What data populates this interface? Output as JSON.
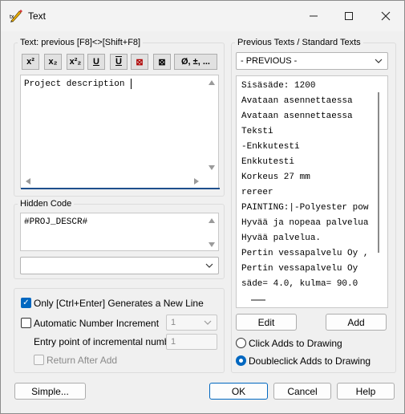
{
  "window": {
    "title": "Text"
  },
  "left": {
    "text_group": {
      "legend": "Text: previous [F8]<>[Shift+F8]",
      "toolbar": [
        {
          "name": "superscript-button",
          "label": "x²"
        },
        {
          "name": "subscript-button",
          "label": "x₂"
        },
        {
          "name": "sub-superscript-button",
          "label": "x²₂"
        },
        {
          "name": "underline-button",
          "label": "U"
        },
        {
          "name": "overline-underline-button",
          "label": "U"
        },
        {
          "name": "boxed-button",
          "label": "⊠"
        },
        {
          "name": "boxed-small-button",
          "label": "⊠"
        },
        {
          "name": "special-characters-button",
          "label": "Ø, ±, ..."
        }
      ],
      "content": "Project description"
    },
    "hidden": {
      "legend": "Hidden Code",
      "content": "#PROJ_DESCR#",
      "combo_value": ""
    },
    "options": {
      "only_ctrl_enter": "Only [Ctrl+Enter] Generates a New Line",
      "auto_number": "Automatic Number Increment",
      "auto_number_value": "1",
      "entry_point_label": "Entry point of incremental number",
      "entry_point_value": "1",
      "return_after_add": "Return After Add"
    }
  },
  "right": {
    "legend": "Previous Texts / Standard Texts",
    "combo_value": "- PREVIOUS -",
    "list": [
      "Sisäsäde: 1200",
      "Avataan asennettaessa",
      "Avataan asennettaessa",
      "Teksti",
      "-Enkkutesti",
      "Enkkutesti",
      "Korkeus 27 mm",
      "rereer",
      "PAINTING:|-Polyester pow",
      "Hyvää ja nopeaa palvelua",
      "Hyvää palvelua.",
      "Pertin vessapalvelu Oy ,",
      "Pertin vessapalvelu Oy",
      "säde= 4.0, kulma= 90.0"
    ],
    "edit": "Edit",
    "add": "Add",
    "click_adds": "Click Adds to Drawing",
    "dblclick_adds": "Doubleclick Adds to Drawing"
  },
  "bottom": {
    "simple": "Simple...",
    "ok": "OK",
    "cancel": "Cancel",
    "help": "Help"
  },
  "colors": {
    "accent": "#0067c0",
    "background": "#f0f0f0"
  }
}
